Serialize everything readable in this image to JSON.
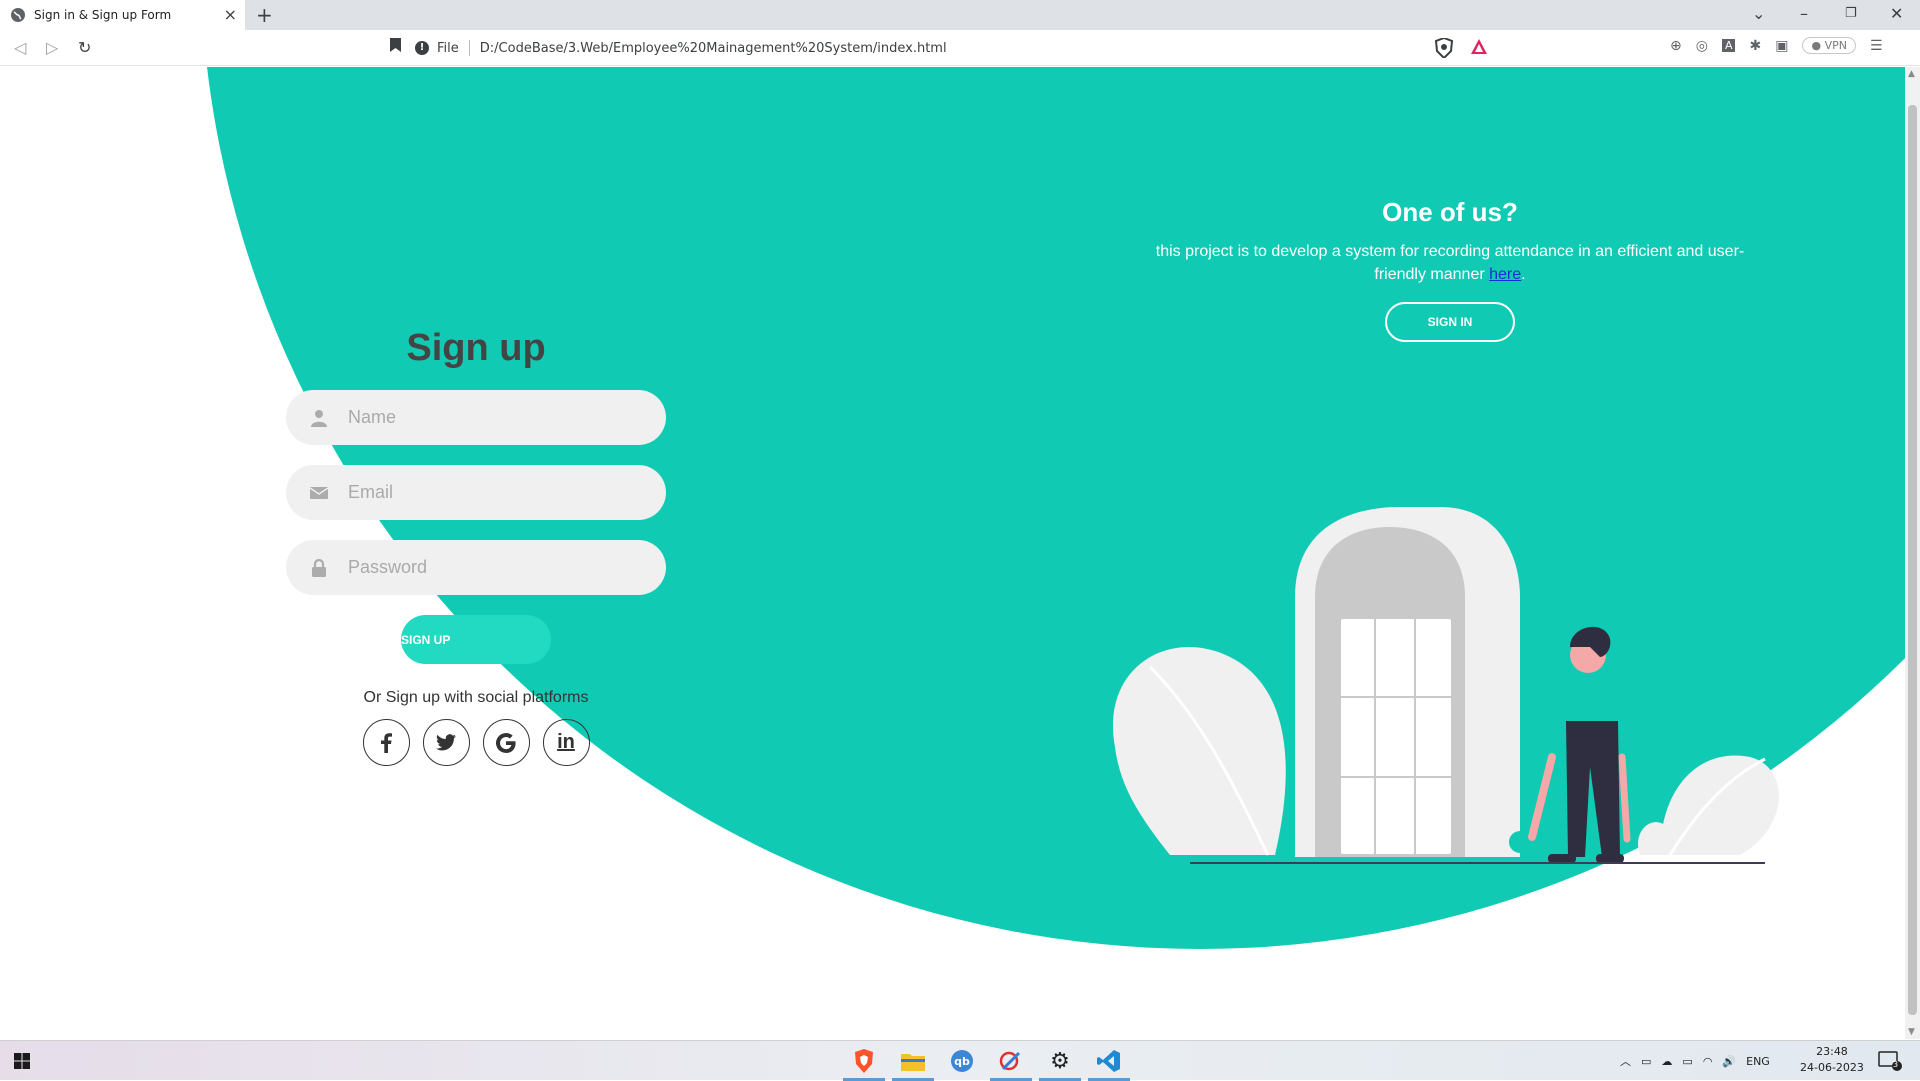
{
  "browser": {
    "tab_title": "Sign in & Sign up Form",
    "address_prefix": "File",
    "url": "D:/CodeBase/3.Web/Employee%20Mainagement%20System/index.html",
    "vpn_label": "VPN"
  },
  "signup": {
    "title": "Sign up",
    "name_placeholder": "Name",
    "email_placeholder": "Email",
    "password_placeholder": "Password",
    "submit_label": "SIGN UP",
    "social_text": "Or Sign up with social platforms",
    "social": [
      {
        "name": "facebook",
        "glyph": "f"
      },
      {
        "name": "twitter",
        "glyph": "t"
      },
      {
        "name": "google",
        "glyph": "G"
      },
      {
        "name": "linkedin",
        "glyph": "in"
      }
    ]
  },
  "panel": {
    "heading": "One of us?",
    "text_before_link": "this project is to develop a system for recording attendance in an efficient and user-friendly manner ",
    "link_text": "here",
    "text_after_link": ".",
    "button_label": "SIGN IN"
  },
  "colors": {
    "accent": "#10cab3",
    "button": "#22d9c1",
    "input_bg": "#f0f0f0",
    "heading": "#444444"
  },
  "taskbar": {
    "language": "ENG",
    "time": "23:48",
    "date": "24-06-2023",
    "notification_count": "3"
  }
}
